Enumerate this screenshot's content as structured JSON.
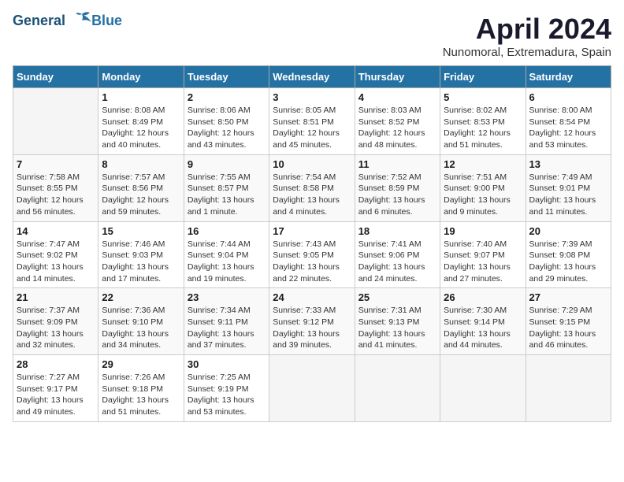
{
  "header": {
    "logo_line1": "General",
    "logo_line2": "Blue",
    "month_title": "April 2024",
    "location": "Nunomoral, Extremadura, Spain"
  },
  "days_of_week": [
    "Sunday",
    "Monday",
    "Tuesday",
    "Wednesday",
    "Thursday",
    "Friday",
    "Saturday"
  ],
  "weeks": [
    [
      {
        "num": "",
        "info": ""
      },
      {
        "num": "1",
        "info": "Sunrise: 8:08 AM\nSunset: 8:49 PM\nDaylight: 12 hours\nand 40 minutes."
      },
      {
        "num": "2",
        "info": "Sunrise: 8:06 AM\nSunset: 8:50 PM\nDaylight: 12 hours\nand 43 minutes."
      },
      {
        "num": "3",
        "info": "Sunrise: 8:05 AM\nSunset: 8:51 PM\nDaylight: 12 hours\nand 45 minutes."
      },
      {
        "num": "4",
        "info": "Sunrise: 8:03 AM\nSunset: 8:52 PM\nDaylight: 12 hours\nand 48 minutes."
      },
      {
        "num": "5",
        "info": "Sunrise: 8:02 AM\nSunset: 8:53 PM\nDaylight: 12 hours\nand 51 minutes."
      },
      {
        "num": "6",
        "info": "Sunrise: 8:00 AM\nSunset: 8:54 PM\nDaylight: 12 hours\nand 53 minutes."
      }
    ],
    [
      {
        "num": "7",
        "info": "Sunrise: 7:58 AM\nSunset: 8:55 PM\nDaylight: 12 hours\nand 56 minutes."
      },
      {
        "num": "8",
        "info": "Sunrise: 7:57 AM\nSunset: 8:56 PM\nDaylight: 12 hours\nand 59 minutes."
      },
      {
        "num": "9",
        "info": "Sunrise: 7:55 AM\nSunset: 8:57 PM\nDaylight: 13 hours\nand 1 minute."
      },
      {
        "num": "10",
        "info": "Sunrise: 7:54 AM\nSunset: 8:58 PM\nDaylight: 13 hours\nand 4 minutes."
      },
      {
        "num": "11",
        "info": "Sunrise: 7:52 AM\nSunset: 8:59 PM\nDaylight: 13 hours\nand 6 minutes."
      },
      {
        "num": "12",
        "info": "Sunrise: 7:51 AM\nSunset: 9:00 PM\nDaylight: 13 hours\nand 9 minutes."
      },
      {
        "num": "13",
        "info": "Sunrise: 7:49 AM\nSunset: 9:01 PM\nDaylight: 13 hours\nand 11 minutes."
      }
    ],
    [
      {
        "num": "14",
        "info": "Sunrise: 7:47 AM\nSunset: 9:02 PM\nDaylight: 13 hours\nand 14 minutes."
      },
      {
        "num": "15",
        "info": "Sunrise: 7:46 AM\nSunset: 9:03 PM\nDaylight: 13 hours\nand 17 minutes."
      },
      {
        "num": "16",
        "info": "Sunrise: 7:44 AM\nSunset: 9:04 PM\nDaylight: 13 hours\nand 19 minutes."
      },
      {
        "num": "17",
        "info": "Sunrise: 7:43 AM\nSunset: 9:05 PM\nDaylight: 13 hours\nand 22 minutes."
      },
      {
        "num": "18",
        "info": "Sunrise: 7:41 AM\nSunset: 9:06 PM\nDaylight: 13 hours\nand 24 minutes."
      },
      {
        "num": "19",
        "info": "Sunrise: 7:40 AM\nSunset: 9:07 PM\nDaylight: 13 hours\nand 27 minutes."
      },
      {
        "num": "20",
        "info": "Sunrise: 7:39 AM\nSunset: 9:08 PM\nDaylight: 13 hours\nand 29 minutes."
      }
    ],
    [
      {
        "num": "21",
        "info": "Sunrise: 7:37 AM\nSunset: 9:09 PM\nDaylight: 13 hours\nand 32 minutes."
      },
      {
        "num": "22",
        "info": "Sunrise: 7:36 AM\nSunset: 9:10 PM\nDaylight: 13 hours\nand 34 minutes."
      },
      {
        "num": "23",
        "info": "Sunrise: 7:34 AM\nSunset: 9:11 PM\nDaylight: 13 hours\nand 37 minutes."
      },
      {
        "num": "24",
        "info": "Sunrise: 7:33 AM\nSunset: 9:12 PM\nDaylight: 13 hours\nand 39 minutes."
      },
      {
        "num": "25",
        "info": "Sunrise: 7:31 AM\nSunset: 9:13 PM\nDaylight: 13 hours\nand 41 minutes."
      },
      {
        "num": "26",
        "info": "Sunrise: 7:30 AM\nSunset: 9:14 PM\nDaylight: 13 hours\nand 44 minutes."
      },
      {
        "num": "27",
        "info": "Sunrise: 7:29 AM\nSunset: 9:15 PM\nDaylight: 13 hours\nand 46 minutes."
      }
    ],
    [
      {
        "num": "28",
        "info": "Sunrise: 7:27 AM\nSunset: 9:17 PM\nDaylight: 13 hours\nand 49 minutes."
      },
      {
        "num": "29",
        "info": "Sunrise: 7:26 AM\nSunset: 9:18 PM\nDaylight: 13 hours\nand 51 minutes."
      },
      {
        "num": "30",
        "info": "Sunrise: 7:25 AM\nSunset: 9:19 PM\nDaylight: 13 hours\nand 53 minutes."
      },
      {
        "num": "",
        "info": ""
      },
      {
        "num": "",
        "info": ""
      },
      {
        "num": "",
        "info": ""
      },
      {
        "num": "",
        "info": ""
      }
    ]
  ]
}
